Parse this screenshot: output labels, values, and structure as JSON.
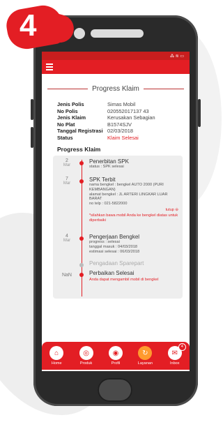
{
  "step_badge": "4",
  "statusbar": {
    "icons": "⁂ ≋ ▭"
  },
  "page_title": "Progress Klaim",
  "info": [
    {
      "key": "Jenis Polis",
      "value": "Simas Mobil"
    },
    {
      "key": "No Polis",
      "value": "020552017137 43"
    },
    {
      "key": "Jenis Klaim",
      "value": "Kerusakan Sebagian"
    },
    {
      "key": "No Plat",
      "value": "B1574SJV"
    },
    {
      "key": "Tanggal Registrasi",
      "value": "02/03/2018"
    },
    {
      "key": "Status",
      "value": "Klaim Selesai"
    }
  ],
  "section_label": "Progress Klaim",
  "timeline": [
    {
      "day": "2",
      "month": "Mar",
      "title": "Penerbitan SPK",
      "lines": [
        "status : SPK selesai"
      ]
    },
    {
      "day": "7",
      "month": "Mar",
      "title": "SPK Terbit",
      "lines": [
        "nama bengkel : bengkel AUTO 2000 (PURI KEMBANGAN)",
        "alamat bengkel : JL ARTERI LINGKAR LUAR BARAT",
        "no telp : 021-5822000"
      ],
      "toggle": "tutup ⊖",
      "note": "*silahkan bawa mobil Anda ke bengkel diatas untuk diperbaiki"
    },
    {
      "day": "4",
      "month": "Mar",
      "title": "Pengerjaan Bengkel",
      "lines": [
        "progress : selesai",
        "tanggal masuk : 04/03/2018",
        "estimasi selesai : 06/03/2018"
      ]
    },
    {
      "day": "",
      "month": "",
      "title": "Pengadaan Sparepart",
      "lines": []
    },
    {
      "day": "NaN",
      "month": "",
      "title": "Perbaikan Selesai",
      "lines": [],
      "note": "Anda dapat mengambil mobil di bengkel"
    }
  ],
  "nav": [
    {
      "label": "Home",
      "icon": "home-icon",
      "glyph": "⌂"
    },
    {
      "label": "Produk",
      "icon": "bag-icon",
      "glyph": "◎"
    },
    {
      "label": "Profil",
      "icon": "profile-icon",
      "glyph": "◉"
    },
    {
      "label": "Layanan",
      "icon": "service-icon",
      "glyph": "↻"
    },
    {
      "label": "Inbox",
      "icon": "inbox-icon",
      "glyph": "✉",
      "badge": "4"
    }
  ],
  "colors": {
    "accent": "#e31e24",
    "active_nav": "#ff9a2e"
  }
}
